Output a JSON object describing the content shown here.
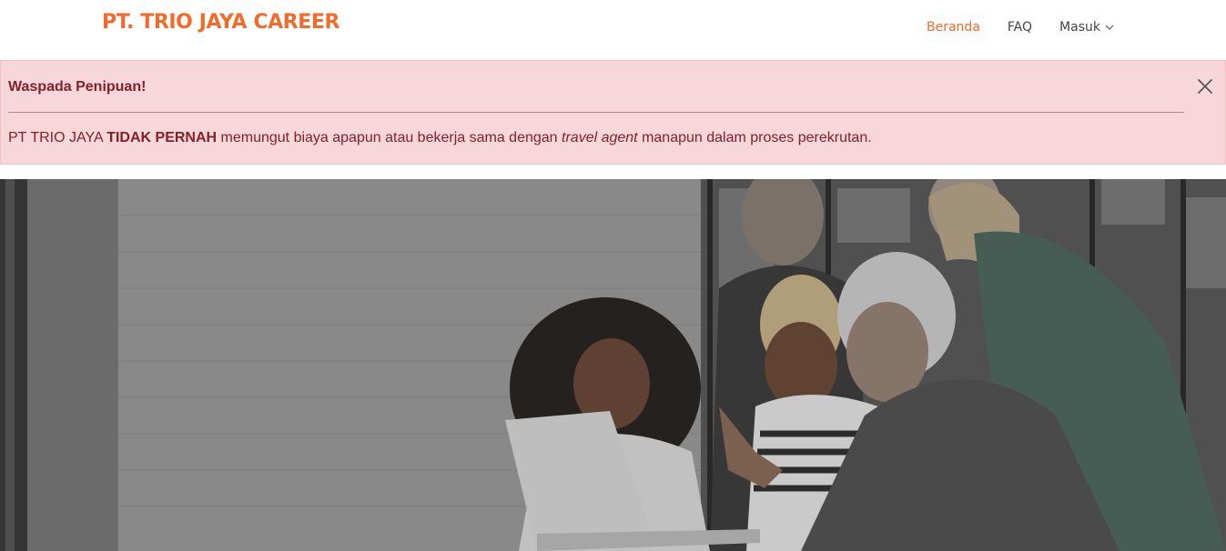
{
  "header": {
    "brand": "PT. TRIO JAYA CAREER",
    "nav": {
      "beranda": "Beranda",
      "faq": "FAQ",
      "masuk": "Masuk"
    },
    "icons": {
      "masuk_dropdown": "chevron-down-icon"
    }
  },
  "alert": {
    "title": "Waspada Penipuan!",
    "body": {
      "part1": "PT TRIO JAYA ",
      "bold": "TIDAK PERNAH",
      "part2": " memungut biaya apapun atau bekerja sama dengan ",
      "italic": "travel agent",
      "part3": " manapun dalam proses perekrutan."
    },
    "icons": {
      "close": "close-icon"
    }
  },
  "hero": {
    "image": "team-working-around-laptop-photo"
  },
  "colors": {
    "brand": "#f26b2a",
    "alert_bg": "#f8d7da",
    "alert_text": "#842029"
  }
}
